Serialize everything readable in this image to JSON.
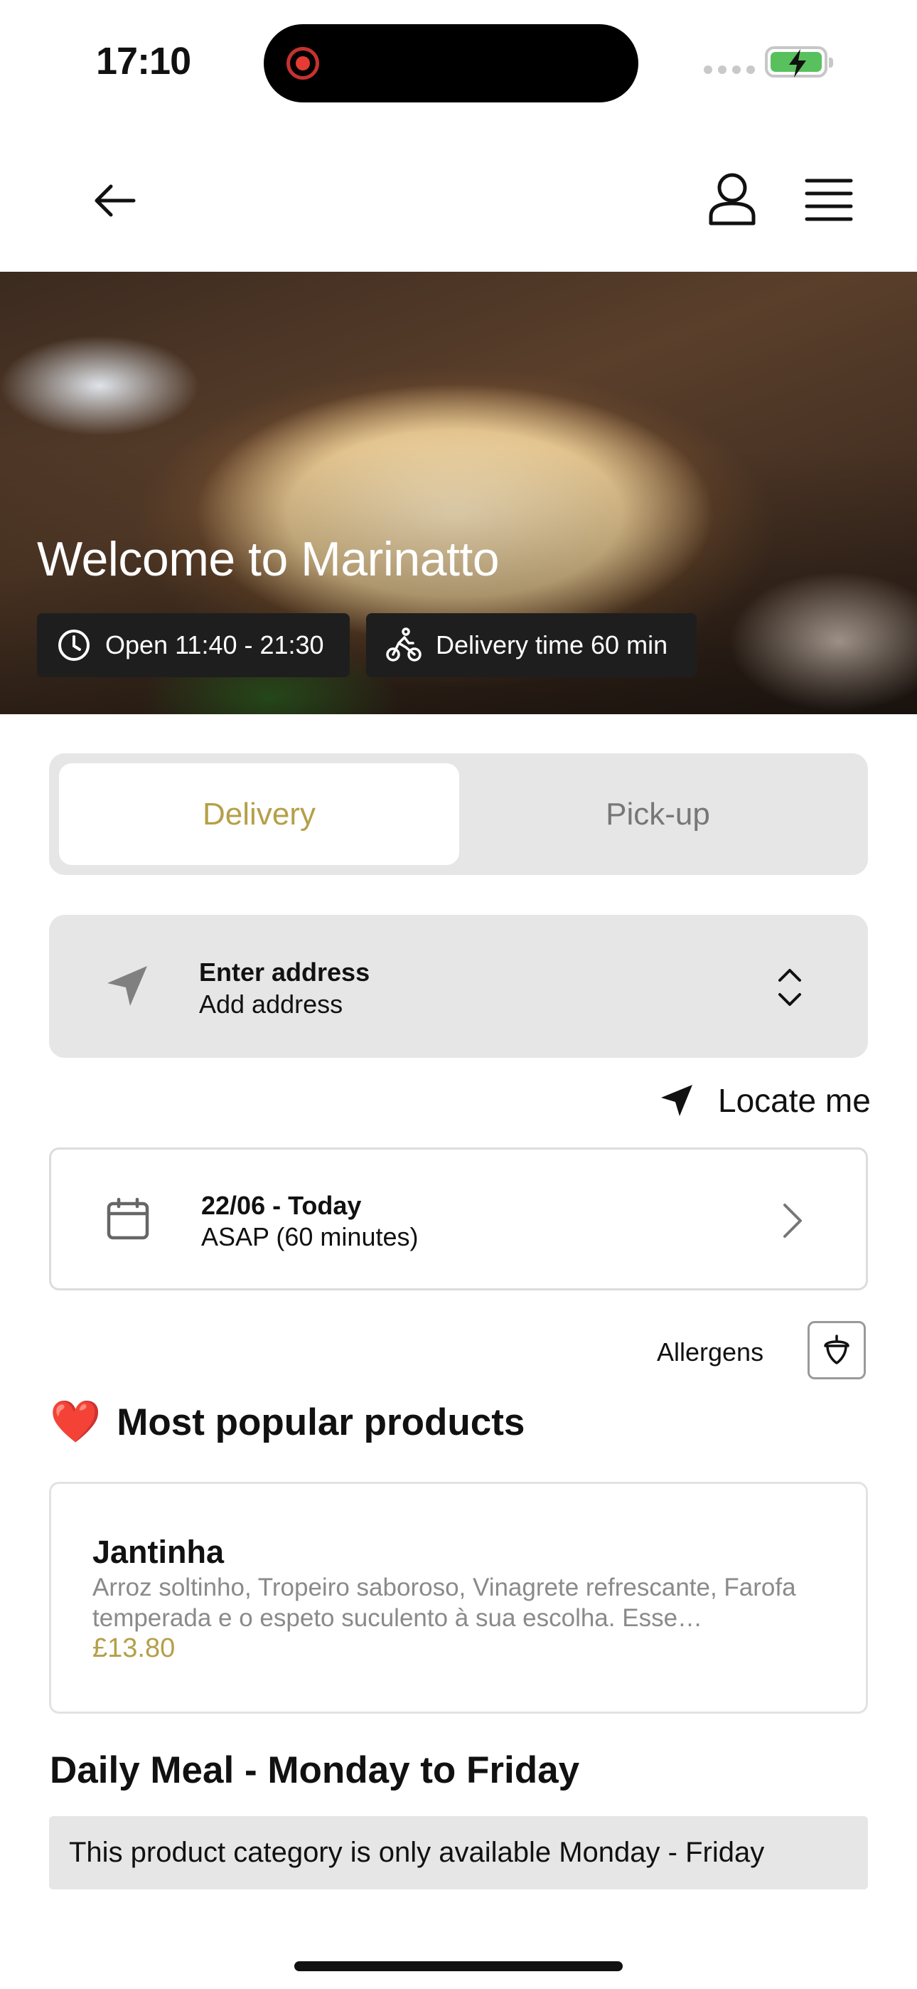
{
  "status": {
    "time": "17:10"
  },
  "hero": {
    "title": "Welcome to Marinatto",
    "open_hours": "Open 11:40 - 21:30",
    "delivery_time": "Delivery time 60 min"
  },
  "order_mode": {
    "options": [
      "Delivery",
      "Pick-up"
    ],
    "selected": "Delivery"
  },
  "address": {
    "title": "Enter address",
    "subtitle": "Add address"
  },
  "locate": {
    "label": "Locate me"
  },
  "schedule": {
    "date": "22/06 - Today",
    "time": "ASAP (60 minutes)"
  },
  "allergens": {
    "label": "Allergens"
  },
  "popular": {
    "title": "Most popular products",
    "emoji": "❤️"
  },
  "products": [
    {
      "name": "Jantinha",
      "description": "Arroz soltinho, Tropeiro saboroso, Vinagrete refrescante, Farofa temperada e o espeto suculento à sua escolha. Esse…",
      "price": "£13.80"
    }
  ],
  "daily": {
    "title": "Daily Meal - Monday to Friday",
    "notice": "This product category is only available Monday - Friday"
  },
  "colors": {
    "accent": "#b59f48",
    "panel": "#e6e6e6"
  }
}
